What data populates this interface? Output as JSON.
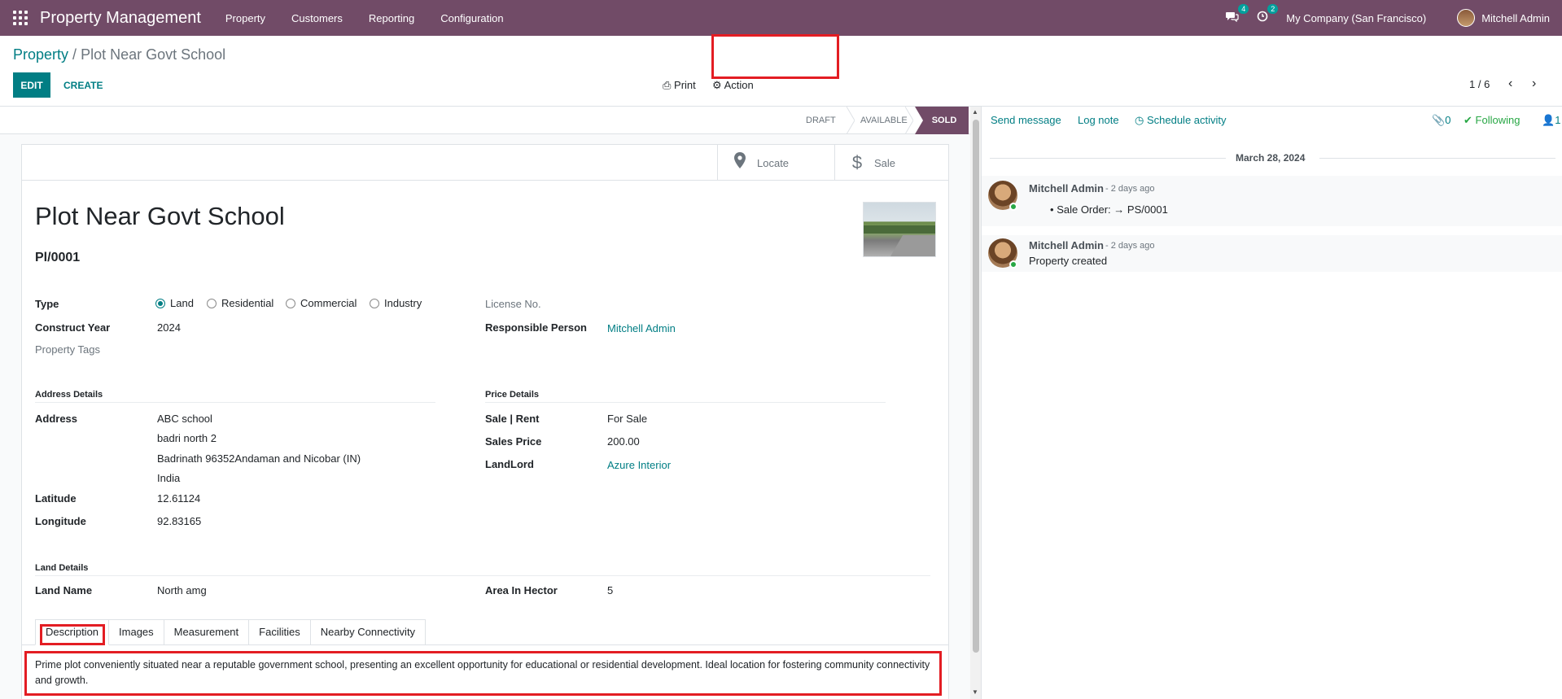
{
  "navbar": {
    "brand": "Property Management",
    "menu": [
      "Property",
      "Customers",
      "Reporting",
      "Configuration"
    ],
    "messages_count": "4",
    "activities_count": "2",
    "company": "My Company (San Francisco)",
    "user": "Mitchell Admin",
    "icons": {
      "apps": "apps-grid-icon",
      "messages": "chat-icon",
      "activities": "clock-icon"
    }
  },
  "control_panel": {
    "breadcrumb_parent": "Property",
    "breadcrumb_sep": "/",
    "breadcrumb_current": "Plot Near Govt School",
    "edit_label": "EDIT",
    "create_label": "CREATE",
    "print_label": "Print",
    "action_label": "Action",
    "pager": "1 / 6"
  },
  "statusbar": {
    "stages": [
      "DRAFT",
      "AVAILABLE",
      "SOLD"
    ],
    "active": "SOLD"
  },
  "smart_buttons": {
    "locate": "Locate",
    "sale": "Sale"
  },
  "record": {
    "title": "Plot Near Govt School",
    "reference": "Pl/0001",
    "type_label": "Type",
    "type_options": [
      "Land",
      "Residential",
      "Commercial",
      "Industry"
    ],
    "type_selected": "Land",
    "construct_year_label": "Construct Year",
    "construct_year": "2024",
    "property_tags_label": "Property Tags",
    "license_label": "License No.",
    "responsible_label": "Responsible Person",
    "responsible": "Mitchell Admin",
    "address_section": "Address Details",
    "address_label": "Address",
    "address_lines": [
      "ABC school",
      "badri north 2",
      "Badrinath  96352Andaman and Nicobar (IN)",
      "India"
    ],
    "latitude_label": "Latitude",
    "latitude": "12.61124",
    "longitude_label": "Longitude",
    "longitude": "92.83165",
    "price_section": "Price Details",
    "sale_rent_label": "Sale | Rent",
    "sale_rent": "For Sale",
    "sales_price_label": "Sales Price",
    "sales_price": "200.00",
    "landlord_label": "LandLord",
    "landlord": "Azure Interior",
    "land_section": "Land Details",
    "land_name_label": "Land Name",
    "land_name": "North amg",
    "area_label": "Area In Hector",
    "area": "5"
  },
  "tabs": [
    "Description",
    "Images",
    "Measurement",
    "Facilities",
    "Nearby Connectivity"
  ],
  "description": "Prime plot conveniently situated near a reputable government school, presenting an excellent opportunity for educational or residential development. Ideal location for fostering community connectivity and growth.",
  "chatter": {
    "send_message": "Send message",
    "log_note": "Log note",
    "schedule_activity": "Schedule activity",
    "attachments": "0",
    "following": "Following",
    "followers": "1",
    "date": "March 28, 2024",
    "messages": [
      {
        "author": "Mitchell Admin",
        "time": "- 2 days ago",
        "bullet_label": "Sale Order:",
        "bullet_value": "PS/0001"
      },
      {
        "author": "Mitchell Admin",
        "time": "- 2 days ago",
        "body": "Property created"
      }
    ]
  }
}
